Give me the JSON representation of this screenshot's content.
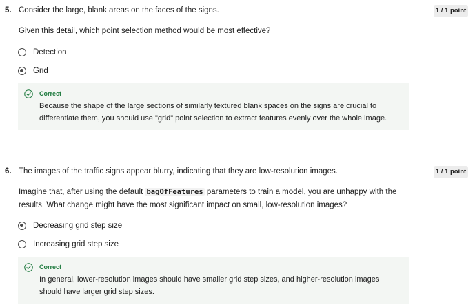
{
  "questions": [
    {
      "number": "5.",
      "text": "Consider the large, blank areas on the faces of the signs.",
      "points": "1 / 1 point",
      "prompt": "Given this detail, which point selection method would be most effective?",
      "options": [
        {
          "label": "Detection",
          "selected": false
        },
        {
          "label": "Grid",
          "selected": true
        }
      ],
      "feedback": {
        "title": "Correct",
        "text": "Because the shape of the large sections of similarly textured blank spaces on the signs are crucial to differentiate them, you should use \"grid\" point selection to extract features evenly over the whole image."
      }
    },
    {
      "number": "6.",
      "text": "The images of the traffic signs appear blurry, indicating that they are low-resolution images.",
      "points": "1 / 1 point",
      "prompt_before": "Imagine that, after using the default ",
      "prompt_code": "bagOfFeatures",
      "prompt_after": " parameters to train a model, you are unhappy with the results. What change might have the most significant impact on small, low-resolution images?",
      "options": [
        {
          "label": "Decreasing grid step size",
          "selected": true
        },
        {
          "label": "Increasing grid step size",
          "selected": false
        }
      ],
      "feedback": {
        "title": "Correct",
        "text": "In general, lower-resolution images should have smaller grid step sizes, and higher-resolution images should have larger grid step sizes."
      }
    }
  ],
  "colors": {
    "correct": "#1e7a3e",
    "feedback_bg": "#f3f6f3",
    "points_bg": "#ececec"
  },
  "icons": {
    "feedback": "check-circle-icon"
  }
}
